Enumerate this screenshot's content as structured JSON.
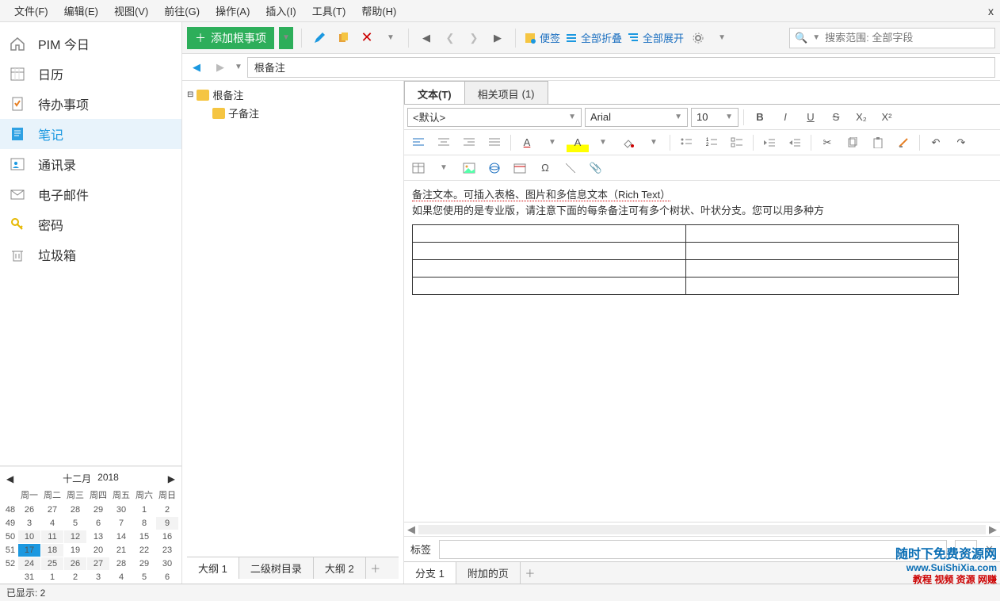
{
  "menu": {
    "file": "文件(F)",
    "edit": "编辑(E)",
    "view": "视图(V)",
    "go": "前往(G)",
    "action": "操作(A)",
    "insert": "插入(I)",
    "tools": "工具(T)",
    "help": "帮助(H)",
    "close": "x"
  },
  "sidebar": {
    "today": "PIM 今日",
    "calendar": "日历",
    "todo": "待办事项",
    "notes": "笔记",
    "contacts": "通讯录",
    "email": "电子邮件",
    "password": "密码",
    "trash": "垃圾箱"
  },
  "calendar": {
    "month": "十二月",
    "year": "2018",
    "wd": [
      "周一",
      "周二",
      "周三",
      "周四",
      "周五",
      "周六",
      "周日"
    ],
    "wk": [
      "48",
      "49",
      "50",
      "51",
      "52",
      ""
    ],
    "rows": [
      [
        {
          "d": "26",
          "c": "dim"
        },
        {
          "d": "27",
          "c": "dim"
        },
        {
          "d": "28",
          "c": "dim"
        },
        {
          "d": "29",
          "c": "dim"
        },
        {
          "d": "30",
          "c": "dim"
        },
        {
          "d": "1",
          "c": "red"
        },
        {
          "d": "2",
          "c": "red"
        }
      ],
      [
        {
          "d": "3"
        },
        {
          "d": "4"
        },
        {
          "d": "5"
        },
        {
          "d": "6"
        },
        {
          "d": "7"
        },
        {
          "d": "8",
          "c": "red"
        },
        {
          "d": "9",
          "c": "red outmo"
        }
      ],
      [
        {
          "d": "10",
          "c": "outmo"
        },
        {
          "d": "11",
          "c": "outmo"
        },
        {
          "d": "12",
          "c": "outmo"
        },
        {
          "d": "13"
        },
        {
          "d": "14"
        },
        {
          "d": "15",
          "c": "red"
        },
        {
          "d": "16",
          "c": "red"
        }
      ],
      [
        {
          "d": "17",
          "c": "today"
        },
        {
          "d": "18",
          "c": "outmo"
        },
        {
          "d": "19"
        },
        {
          "d": "20"
        },
        {
          "d": "21"
        },
        {
          "d": "22",
          "c": "red"
        },
        {
          "d": "23",
          "c": "red"
        }
      ],
      [
        {
          "d": "24",
          "c": "outmo"
        },
        {
          "d": "25",
          "c": "outmo"
        },
        {
          "d": "26",
          "c": "outmo"
        },
        {
          "d": "27",
          "c": "outmo"
        },
        {
          "d": "28"
        },
        {
          "d": "29",
          "c": "red"
        },
        {
          "d": "30",
          "c": "red"
        }
      ],
      [
        {
          "d": "31"
        },
        {
          "d": "1",
          "c": "dim"
        },
        {
          "d": "2",
          "c": "dim"
        },
        {
          "d": "3",
          "c": "dim"
        },
        {
          "d": "4",
          "c": "dim"
        },
        {
          "d": "5",
          "c": "dim red"
        },
        {
          "d": "6",
          "c": "dim red"
        }
      ]
    ]
  },
  "toolbar": {
    "add_root": "添加根事项",
    "sticky": "便签",
    "collapse_all": "全部折叠",
    "expand_all": "全部展开",
    "search_ph": "搜索范围: 全部字段"
  },
  "breadcrumb": {
    "text": "根备注"
  },
  "tree": {
    "root": "根备注",
    "child": "子备注"
  },
  "tabs": {
    "text": "文本(T)",
    "related": "相关项目",
    "related_count": "(1)"
  },
  "fmt": {
    "style": "<默认>",
    "font": "Arial",
    "size": "10"
  },
  "doc": {
    "line1": "备注文本。可插入表格、图片和多信息文本（Rich Text）",
    "line2": "如果您使用的是专业版，请注意下面的每条备注可有多个树状、叶状分支。您可以用多种方"
  },
  "tag": {
    "label": "标签",
    "dots": "..."
  },
  "btabs_left": {
    "a": "大纲 1",
    "b": "二级树目录",
    "c": "大纲 2"
  },
  "btabs_right": {
    "a": "分支 1",
    "b": "附加的页"
  },
  "status": {
    "text": "已显示: 2"
  },
  "wm": {
    "l1": "随时下免费资源网",
    "l2": "www.SuiShiXia.com",
    "l3": "教程 视频 资源 网赚"
  }
}
